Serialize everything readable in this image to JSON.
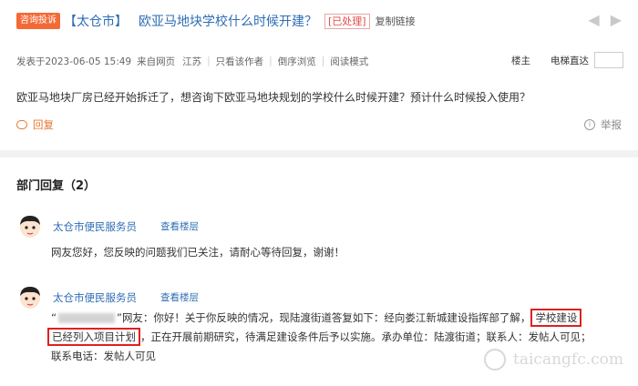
{
  "post": {
    "tag": "咨询投诉",
    "city": "【太仓市】",
    "title": "欧亚马地块学校什么时候开建？",
    "status": "[已处理]",
    "copy_link": "复制链接",
    "meta": {
      "posted": "发表于2023-06-05 15:49",
      "source": "来自网页",
      "location": "江苏",
      "only_author": "只看该作者",
      "reverse": "倒序浏览",
      "read_mode": "阅读模式",
      "owner": "楼主",
      "jump_floor": "电梯直达"
    },
    "body": "欧亚马地块厂房已经开始拆迁了，想咨询下欧亚马地块规划的学校什么时候开建？预计什么时候投入使用？",
    "reply_label": "回复",
    "report_label": "举报"
  },
  "section": {
    "title": "部门回复（2）"
  },
  "replies": [
    {
      "name": "太仓市便民服务员",
      "floor_link": "查看楼层",
      "text": "网友您好，您反映的问题我们已关注，请耐心等待回复，谢谢！"
    },
    {
      "name": "太仓市便民服务员",
      "floor_link": "查看楼层",
      "quote_open": "“",
      "quote_close": "”",
      "line1_a": "网友：你好！关于你反映的情况，现陆渡街道答复如下：经向娄江新城建设指挥部了解，",
      "hl1": "学校建设",
      "hl2": "已经列入项目计划",
      "line2_b": "，正在开展前期研究，待满足建设条件后予以实施。承办单位：陆渡街道；联系人：发帖人可见；",
      "line3": "联系电话：发帖人可见"
    }
  ],
  "watermark": "taicangfc.com",
  "colors": {
    "accent_blue": "#2f6db5",
    "tag_orange": "#f46a37",
    "status_red": "#e24a4a",
    "highlight_red": "#e02020"
  }
}
